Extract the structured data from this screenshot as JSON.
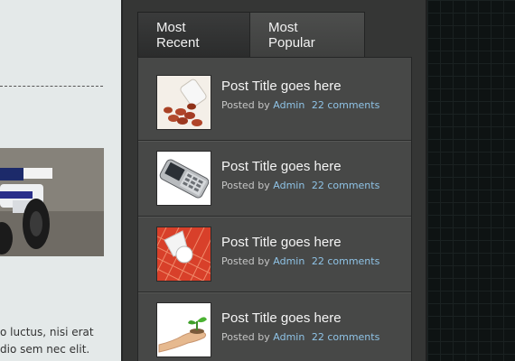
{
  "left_column": {
    "text_lines": [
      "o luctus, nisi erat",
      "dio sem nec elit."
    ]
  },
  "tabs": [
    {
      "label": "Most Recent",
      "active": true
    },
    {
      "label": "Most Popular",
      "active": false
    }
  ],
  "posts": [
    {
      "title": "Post Title goes here",
      "posted_by": "Posted by",
      "author": "Admin",
      "comments": "22 comments",
      "thumbnail": "pills-icon"
    },
    {
      "title": "Post Title goes here",
      "posted_by": "Posted by",
      "author": "Admin",
      "comments": "22 comments",
      "thumbnail": "phone-icon"
    },
    {
      "title": "Post Title goes here",
      "posted_by": "Posted by",
      "author": "Admin",
      "comments": "22 comments",
      "thumbnail": "shuttlecock-icon"
    },
    {
      "title": "Post Title goes here",
      "posted_by": "Posted by",
      "author": "Admin",
      "comments": "22 comments",
      "thumbnail": "seedling-hand-icon"
    }
  ],
  "colors": {
    "panel": "#353635",
    "post_bg": "#474847",
    "link": "#8fc3e6",
    "left_bg": "#e4e9e9"
  }
}
